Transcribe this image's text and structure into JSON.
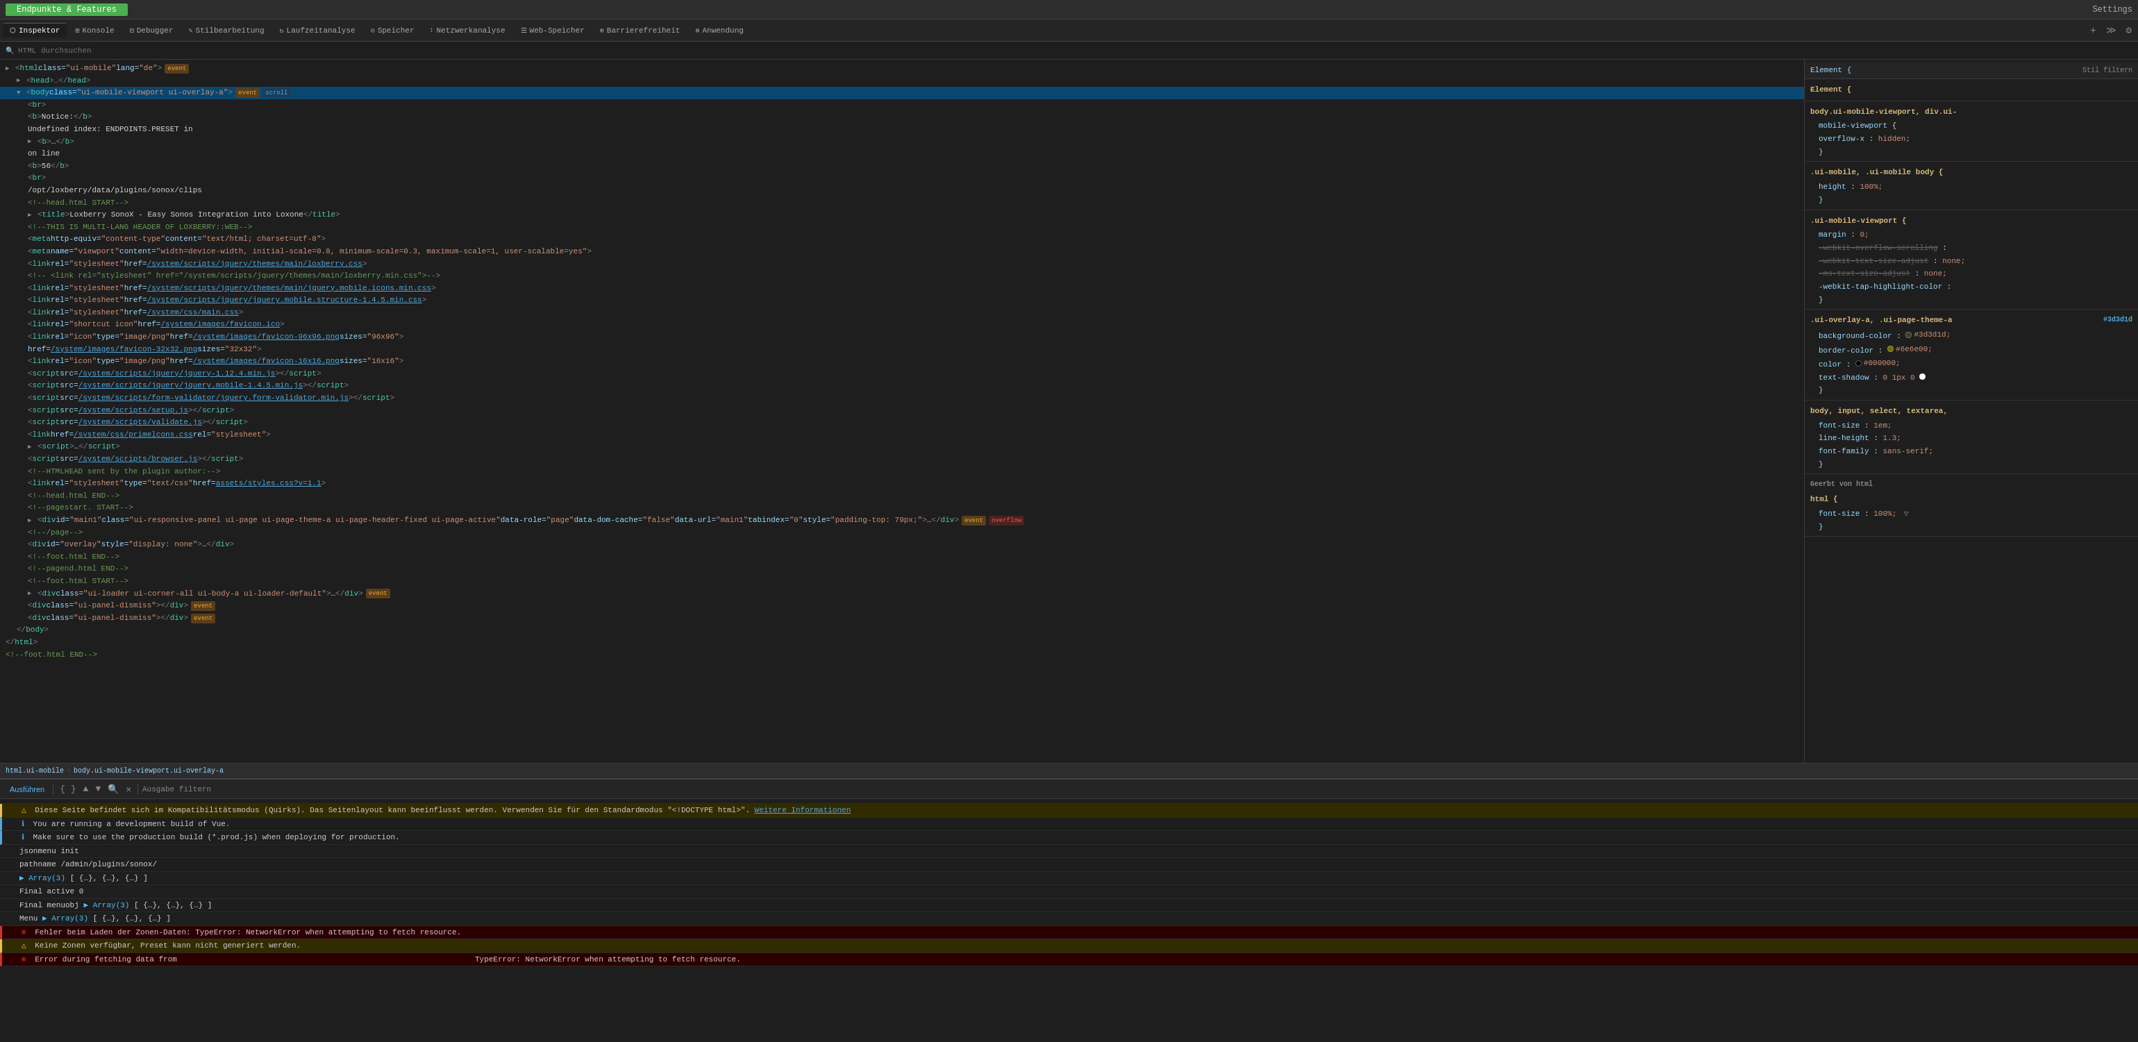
{
  "topbar": {
    "title": "Endpunkte & Features",
    "settings": "Settings"
  },
  "devtools_tabs": [
    {
      "label": "Inspektor",
      "icon": "⬡",
      "active": true
    },
    {
      "label": "Konsole",
      "icon": "⊞",
      "active": false
    },
    {
      "label": "Debugger",
      "icon": "⊟",
      "active": false
    },
    {
      "label": "Stilbearbeitung",
      "icon": "✎",
      "active": false
    },
    {
      "label": "Laufzeitanalyse",
      "icon": "↻",
      "active": false
    },
    {
      "label": "Speicher",
      "icon": "⊙",
      "active": false
    },
    {
      "label": "Netzwerkanalyse",
      "icon": "↕",
      "active": false
    },
    {
      "label": "Web-Speicher",
      "icon": "☰",
      "active": false
    },
    {
      "label": "Barrierefreiheit",
      "icon": "⊕",
      "active": false
    },
    {
      "label": "Anwendung",
      "icon": "⊗",
      "active": false
    }
  ],
  "search_placeholder": "HTML durchsuchen",
  "html_tree": {
    "breadcrumb": "html.ui-mobile › body.ui-mobile-viewport.ui-overlay-a"
  },
  "css_panel": {
    "header": "Stil filtern",
    "element_label": "Element {",
    "sections": [
      {
        "selector": "body.ui-mobile-viewport, div.ui-",
        "source": "",
        "rules": [
          {
            "prop": "mobile-viewport",
            "value": "",
            "comment": true
          },
          {
            "prop": "overflow-x",
            "value": "hidden;"
          }
        ]
      },
      {
        "selector": ".ui-mobile, .ui-mobile body {",
        "source": "",
        "rules": [
          {
            "prop": "height",
            "value": "100%;",
            "strikethrough": false
          }
        ]
      },
      {
        "selector": ".ui-mobile-viewport {",
        "source": "",
        "rules": [
          {
            "prop": "margin",
            "value": "0;"
          },
          {
            "prop": "-webkit-overflow-scrolling",
            "value": "",
            "strikethrough": false
          },
          {
            "prop": "-webkit-text-size-adjust",
            "value": "none;",
            "strikethrough": true
          },
          {
            "prop": "-ms-text-size-adjust",
            "value": "none;",
            "strikethrough": true
          },
          {
            "prop": "-webkit-tap-highlight-color",
            "value": ""
          }
        ]
      },
      {
        "selector": ".ui-overlay-a, .ui-page-theme-a",
        "source": "#3d3d1d",
        "rules": [
          {
            "prop": "background-color",
            "value": "#3d3d1d",
            "color": "#3d3d1d"
          },
          {
            "prop": "border-color",
            "value": "#6e6e00",
            "color": "#6e6e00"
          },
          {
            "prop": "color",
            "value": "#000000",
            "color": "#000000"
          },
          {
            "prop": "text-shadow",
            "value": "0 1px 0 ●"
          }
        ]
      },
      {
        "selector": "body, input, select, textarea,",
        "source": "",
        "rules": [
          {
            "prop": "font-size",
            "value": "1em;"
          },
          {
            "prop": "line-height",
            "value": "1.3;"
          },
          {
            "prop": "font-family",
            "value": "sans-serif;"
          }
        ]
      },
      {
        "selector": "Geerbt von html",
        "source": "",
        "rules": []
      },
      {
        "selector": "html {",
        "source": "",
        "rules": [
          {
            "prop": "font-size",
            "value": "100%;",
            "strikethrough": false
          }
        ]
      }
    ]
  },
  "console": {
    "run_label": "Ausführen",
    "filter_label": "Ausgabe filtern",
    "messages": [
      {
        "type": "warning",
        "num": "1",
        "text": "Diese Seite befindet sich im Kompatibilitätsmodus (Quirks). Das Seitenlayout kann beeinflusst werden. Verwenden Sie für den Standardmodus \"<!DOCTYPE html>\".",
        "link": "Weitere Informationen"
      },
      {
        "type": "info",
        "text": "You are running a development build of Vue."
      },
      {
        "type": "info",
        "text": "Make sure to use the production build (*.prod.js) when deploying for production."
      },
      {
        "type": "log",
        "text": "jsonmenu init"
      },
      {
        "type": "log",
        "text": "pathname /admin/plugins/sonox/"
      },
      {
        "type": "log",
        "text": "▶ Array(3) [ {…}, {…}, {…} ]"
      },
      {
        "type": "log",
        "text": "Final active 0"
      },
      {
        "type": "log",
        "text": "Final menuobj ▶ Array(3) [ {…}, {…}, {…} ]"
      },
      {
        "type": "log",
        "text": "Menu ▶ Array(3) [ {…}, {…}, {…} ]"
      },
      {
        "type": "error",
        "text": "⊗ Fehler beim Laden der Zonen-Daten: TypeError: NetworkError when attempting to fetch resource."
      },
      {
        "type": "warning",
        "text": "△ Keine Zonen verfügbar, Preset kann nicht generiert werden."
      },
      {
        "type": "error",
        "text": "⊗ Error during fetching data from",
        "suffix": "TypeError: NetworkError when attempting to fetch resource."
      }
    ]
  }
}
